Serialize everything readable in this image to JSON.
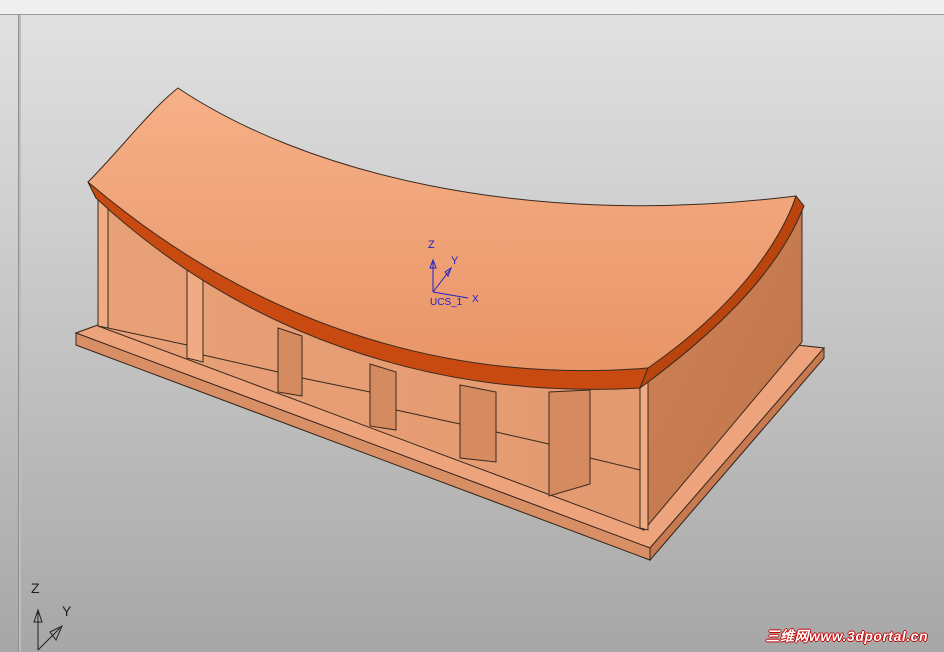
{
  "viewport": {
    "background_top": "#e2e2e2",
    "background_bottom": "#a7a7a7"
  },
  "model": {
    "color_face": "#e6956a",
    "color_top": "#f2a27a",
    "color_edge": "#c84a10"
  },
  "ucs": {
    "z_label": "Z",
    "y_label": "Y",
    "name_label": "UCS_1",
    "x_label": "X"
  },
  "wcs": {
    "z_label": "Z",
    "y_label": "Y"
  },
  "watermark": {
    "text": "三维网www.3dportal.cn"
  }
}
